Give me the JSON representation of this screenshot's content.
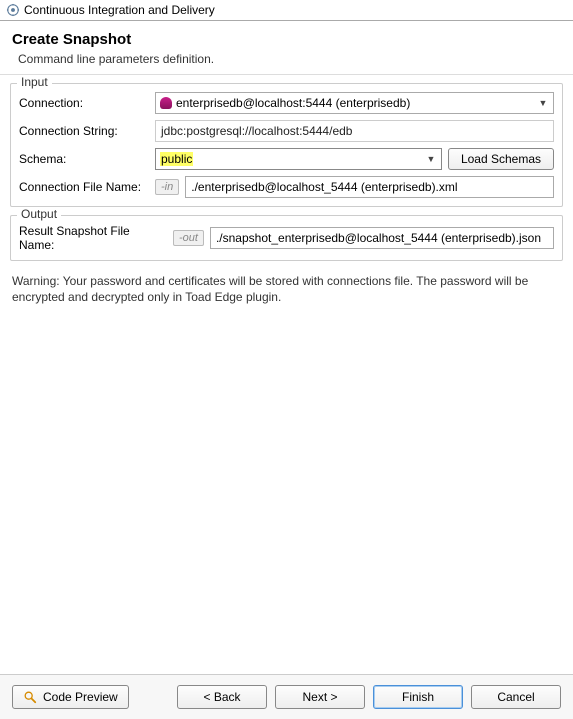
{
  "window": {
    "title": "Continuous Integration and Delivery"
  },
  "header": {
    "title": "Create Snapshot",
    "subtitle": "Command line parameters definition."
  },
  "input_group": {
    "legend": "Input",
    "connection_label": "Connection:",
    "connection_value": "enterprisedb@localhost:5444 (enterprisedb)",
    "connstr_label": "Connection String:",
    "connstr_value": "jdbc:postgresql://localhost:5444/edb",
    "schema_label": "Schema:",
    "schema_value": "public",
    "load_schemas_btn": "Load Schemas",
    "conn_file_label": "Connection File Name:",
    "conn_file_flag": "-in",
    "conn_file_value": "./enterprisedb@localhost_5444 (enterprisedb).xml"
  },
  "output_group": {
    "legend": "Output",
    "result_label": "Result Snapshot File Name:",
    "result_flag": "-out",
    "result_value": "./snapshot_enterprisedb@localhost_5444 (enterprisedb).json"
  },
  "warning": "Warning: Your password and certificates will be stored with connections file. The password will be encrypted and decrypted only in Toad Edge plugin.",
  "footer": {
    "code_preview": "Code Preview",
    "back": "< Back",
    "next": "Next >",
    "finish": "Finish",
    "cancel": "Cancel"
  }
}
